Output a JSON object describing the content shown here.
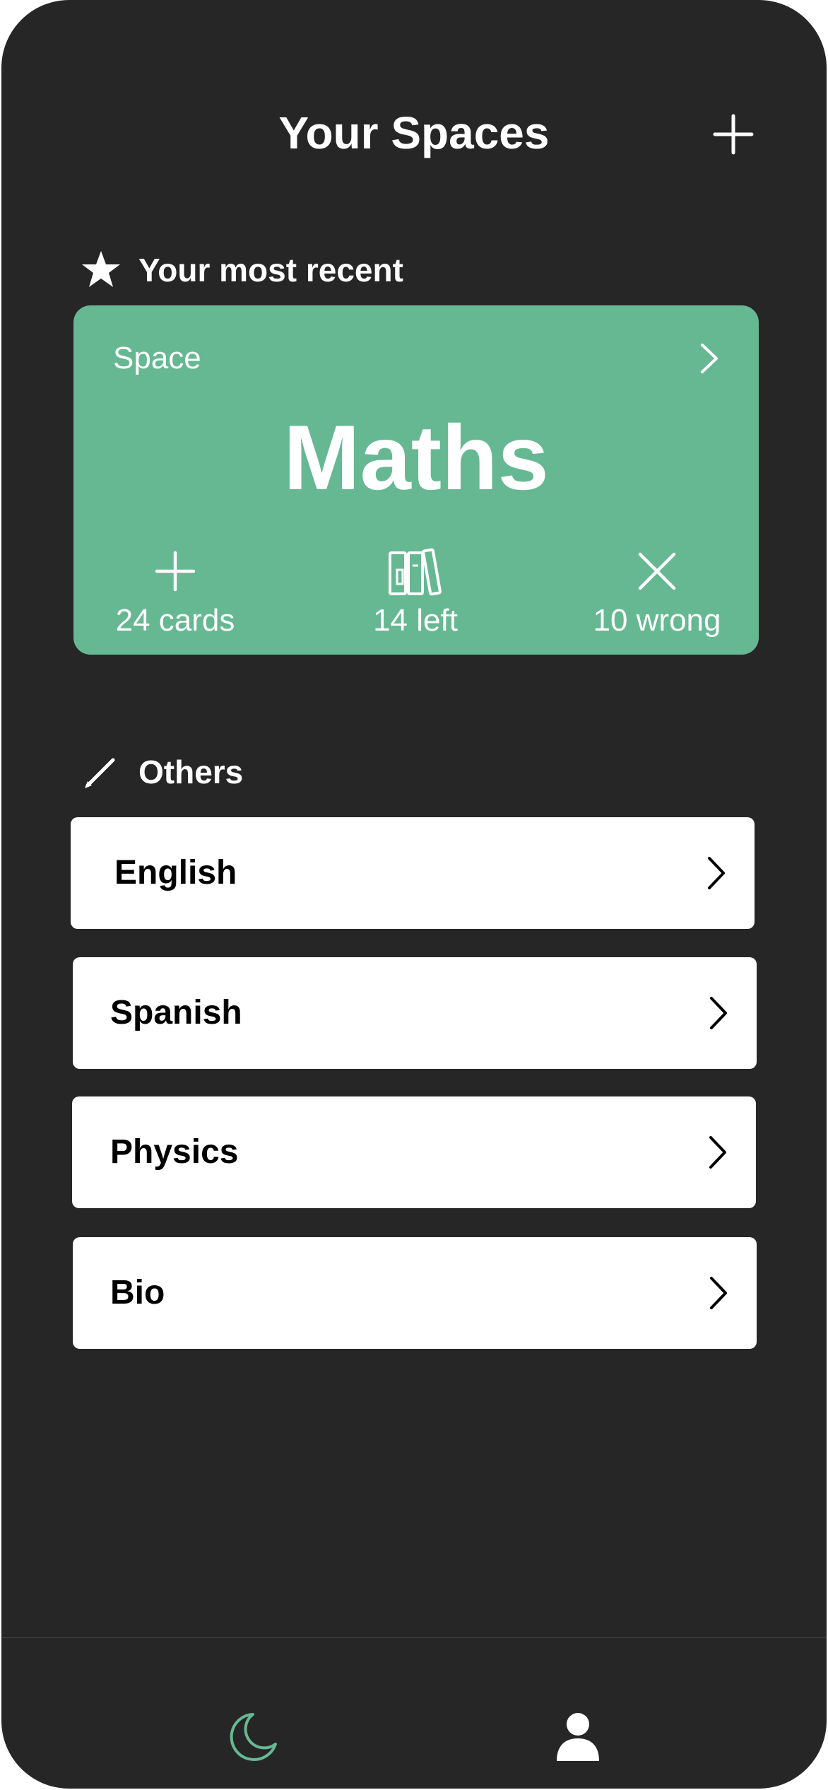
{
  "header": {
    "title": "Your Spaces",
    "add_icon": "plus-icon"
  },
  "recent": {
    "heading": "Your most recent",
    "heading_icon": "star-icon",
    "card": {
      "label": "Space",
      "subject": "Maths",
      "chevron_icon": "chevron-right-icon",
      "stats": [
        {
          "icon": "plus-icon",
          "text": "24 cards"
        },
        {
          "icon": "books-icon",
          "text": "14 left"
        },
        {
          "icon": "close-icon",
          "text": "10 wrong"
        }
      ]
    }
  },
  "others": {
    "heading": "Others",
    "heading_icon": "pencil-icon",
    "items": [
      {
        "label": "English"
      },
      {
        "label": "Spanish"
      },
      {
        "label": "Physics"
      },
      {
        "label": "Bio"
      }
    ]
  },
  "tabbar": {
    "tabs": [
      {
        "name": "moon-icon",
        "active": true
      },
      {
        "name": "person-icon",
        "active": false
      }
    ]
  },
  "colors": {
    "background": "#262626",
    "accent": "#66b893",
    "card": "#ffffff",
    "text_light": "#ffffff",
    "text_dark": "#000000"
  }
}
